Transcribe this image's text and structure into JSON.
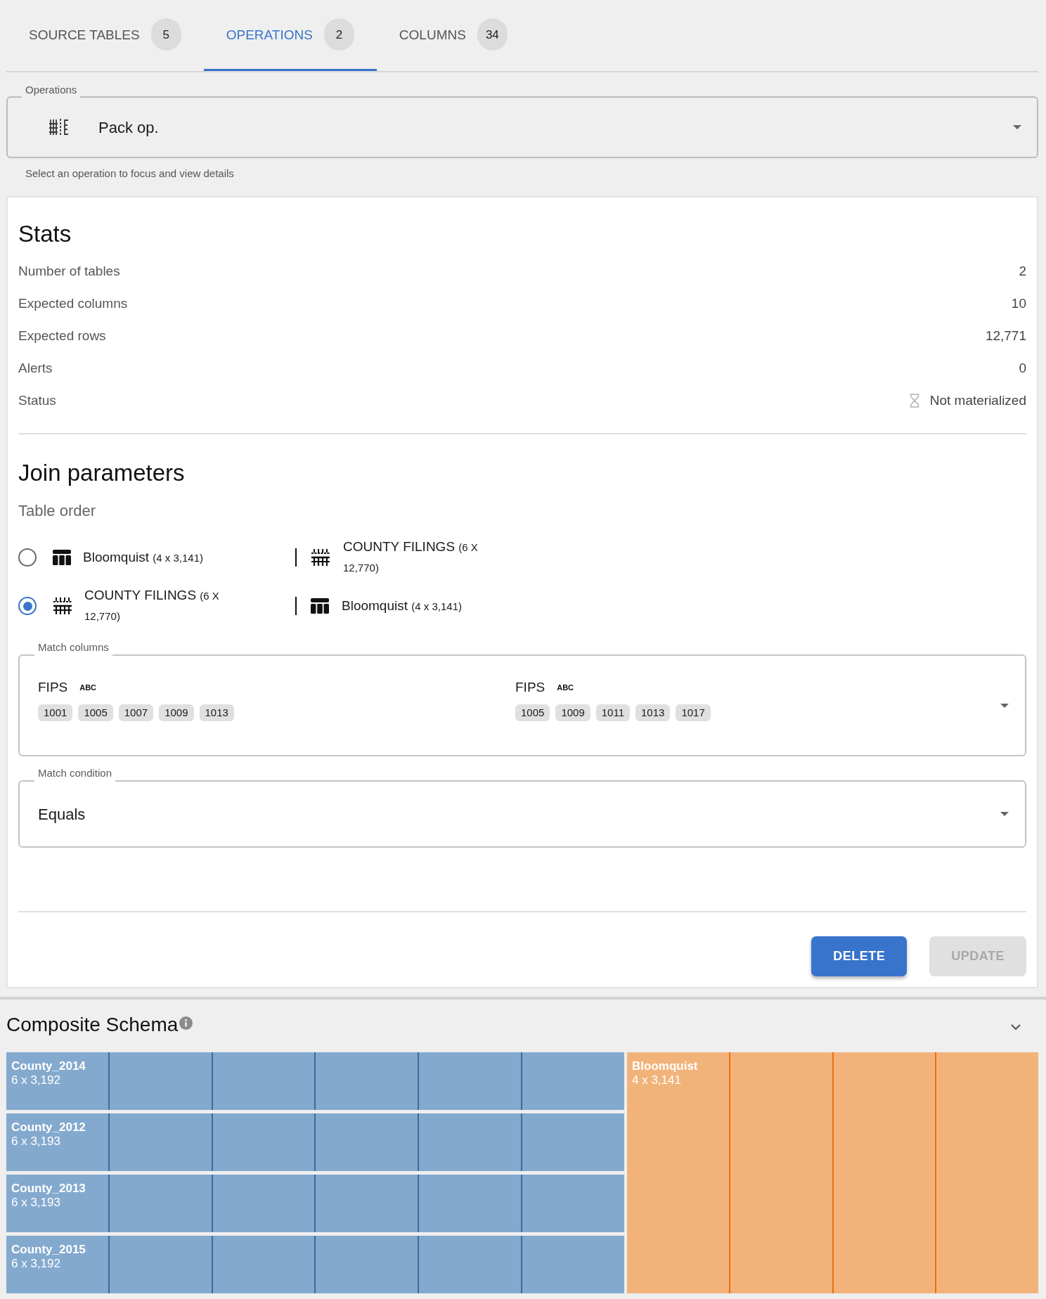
{
  "tabs": [
    {
      "label": "SOURCE TABLES",
      "count": "5",
      "selected": false
    },
    {
      "label": "OPERATIONS",
      "count": "2",
      "selected": true
    },
    {
      "label": "COLUMNS",
      "count": "34",
      "selected": false
    }
  ],
  "operations_select": {
    "label": "Operations",
    "value": "Pack op.",
    "helper_text": "Select an operation to focus and view details"
  },
  "stats": {
    "title": "Stats",
    "rows": [
      {
        "kind": "number",
        "label": "Number of tables",
        "value": "2"
      },
      {
        "kind": "number",
        "label": "Expected columns",
        "value": "10"
      },
      {
        "kind": "number",
        "label": "Expected rows",
        "value": "12,771"
      },
      {
        "kind": "number",
        "label": "Alerts",
        "value": "0"
      },
      {
        "kind": "status",
        "label": "Status",
        "value": "Not materialized"
      }
    ]
  },
  "join_parameters": {
    "title": "Join parameters",
    "table_order": {
      "label": "Table order",
      "options": [
        {
          "selected": false,
          "tables": [
            {
              "kind": "single",
              "name": "Bloomquist",
              "size": "(4 x 3,141)"
            },
            {
              "kind": "stacked",
              "name": "COUNTY FILINGS",
              "size": "(6 X 12,770)"
            }
          ]
        },
        {
          "selected": true,
          "tables": [
            {
              "kind": "stacked",
              "name": "COUNTY FILINGS",
              "size": "(6 X 12,770)"
            },
            {
              "kind": "single",
              "name": "Bloomquist",
              "size": "(4 x 3,141)"
            }
          ]
        }
      ]
    },
    "match_columns": {
      "label": "Match columns",
      "columns": [
        {
          "name": "FIPS",
          "type": "ABC",
          "samples": [
            "1001",
            "1005",
            "1007",
            "1009",
            "1013"
          ]
        },
        {
          "name": "FIPS",
          "type": "ABC",
          "samples": [
            "1005",
            "1009",
            "1011",
            "1013",
            "1017"
          ]
        }
      ]
    },
    "match_condition": {
      "label": "Match condition",
      "value": "Equals"
    }
  },
  "actions": [
    {
      "label": "DELETE",
      "disabled": false
    },
    {
      "label": "UPDATE",
      "disabled": true
    }
  ],
  "composite_schema": {
    "title": "Composite Schema",
    "groups": [
      {
        "color": "#84a9ce",
        "tables": [
          {
            "name": "County_2014",
            "size": "6 x 3,192"
          },
          {
            "name": "County_2012",
            "size": "6 x 3,193"
          },
          {
            "name": "County_2013",
            "size": "6 x 3,193"
          },
          {
            "name": "County_2015",
            "size": "6 x 3,192"
          }
        ]
      },
      {
        "color": "#f2b37a",
        "tables": [
          {
            "name": "Bloomquist",
            "size": "4 x 3,141"
          }
        ]
      }
    ]
  }
}
